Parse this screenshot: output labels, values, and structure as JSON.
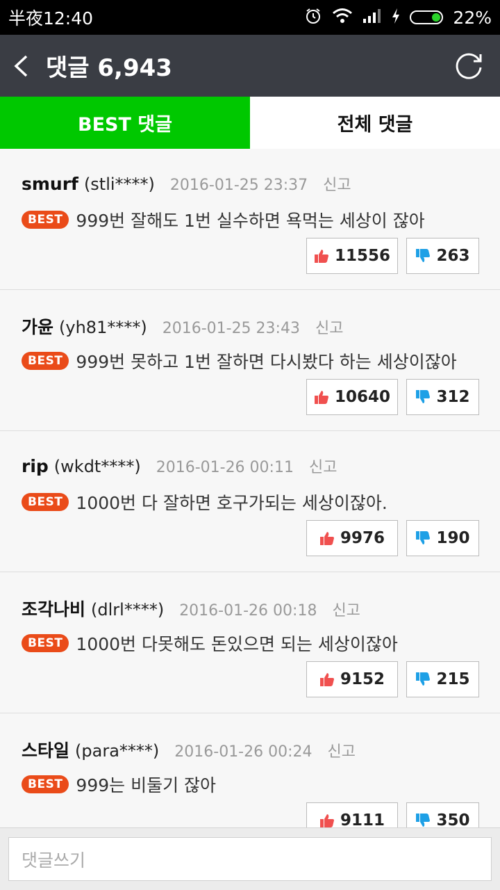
{
  "status_bar": {
    "time": "半夜12:40",
    "battery": "22%"
  },
  "header": {
    "title": "댓글 6,943"
  },
  "tabs": [
    {
      "label": "BEST 댓글",
      "active": true
    },
    {
      "label": "전체 댓글",
      "active": false
    }
  ],
  "comments": [
    {
      "nick": "smurf",
      "id": "(stli****)",
      "date": "2016-01-25 23:37",
      "report": "신고",
      "badge": "BEST",
      "text": "999번 잘해도 1번 실수하면 욕먹는 세상이 잖아",
      "up": "11556",
      "down": "263"
    },
    {
      "nick": "가윤",
      "id": "(yh81****)",
      "date": "2016-01-25 23:43",
      "report": "신고",
      "badge": "BEST",
      "text": "999번 못하고 1번 잘하면 다시봤다 하는 세상이잖아",
      "up": "10640",
      "down": "312"
    },
    {
      "nick": "rip",
      "id": "(wkdt****)",
      "date": "2016-01-26 00:11",
      "report": "신고",
      "badge": "BEST",
      "text": "1000번 다 잘하면 호구가되는 세상이잖아.",
      "up": "9976",
      "down": "190"
    },
    {
      "nick": "조각나비",
      "id": "(dlrl****)",
      "date": "2016-01-26 00:18",
      "report": "신고",
      "badge": "BEST",
      "text": "1000번 다못해도 돈있으면 되는 세상이잖아",
      "up": "9152",
      "down": "215"
    },
    {
      "nick": "스타일",
      "id": "(para****)",
      "date": "2016-01-26 00:24",
      "report": "신고",
      "badge": "BEST",
      "text": "999는 비둘기 잖아",
      "up": "9111",
      "down": "350"
    }
  ],
  "input": {
    "placeholder": "댓글쓰기"
  },
  "colors": {
    "header": "#3a3d44",
    "best_tab": "#00c800",
    "badge": "#ea4b19",
    "like": "#f0504f",
    "dislike": "#1ea0e6"
  }
}
